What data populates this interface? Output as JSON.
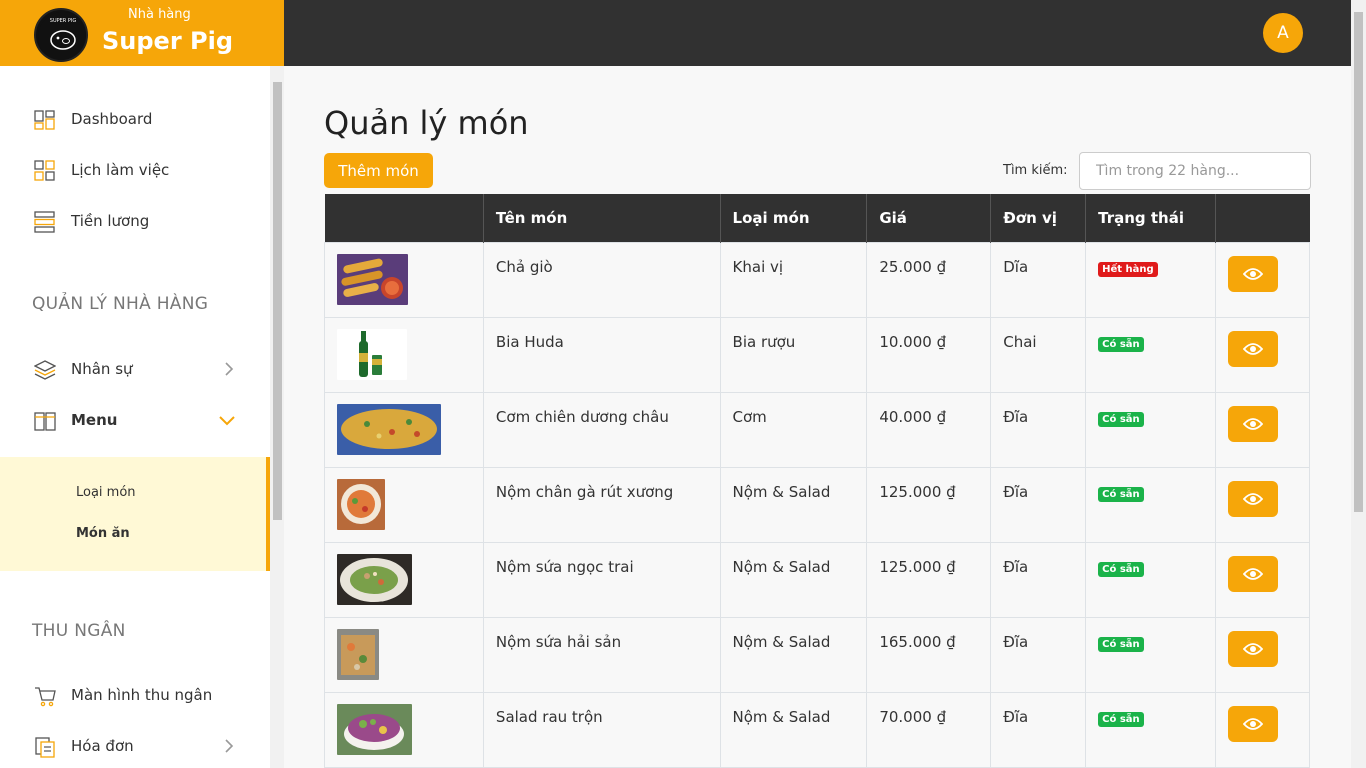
{
  "brand": {
    "subtitle": "Nhà hàng",
    "name": "Super Pig",
    "logo_text": "SUPER PIG"
  },
  "user": {
    "avatar_initial": "A"
  },
  "sidebar": {
    "items": [
      {
        "label": "Dashboard",
        "icon": "dashboard-icon"
      },
      {
        "label": "Lịch làm việc",
        "icon": "grid-icon"
      },
      {
        "label": "Tiền lương",
        "icon": "list-icon"
      }
    ],
    "section_restaurant": "QUẢN LÝ NHÀ HÀNG",
    "staff": {
      "label": "Nhân sự",
      "icon": "layers-icon"
    },
    "menu": {
      "label": "Menu",
      "icon": "book-icon",
      "sub_items": [
        "Loại món",
        "Món ăn"
      ]
    },
    "section_cashier": "THU NGÂN",
    "cashier_screen": {
      "label": "Màn hình thu ngân",
      "icon": "cart-icon"
    },
    "invoices": {
      "label": "Hóa đơn",
      "icon": "invoice-icon"
    }
  },
  "page": {
    "title": "Quản lý món",
    "add_button": "Thêm món",
    "search_label": "Tìm kiếm:",
    "search_placeholder": "Tìm trong 22 hàng..."
  },
  "table": {
    "headers": [
      "",
      "Tên món",
      "Loại món",
      "Giá",
      "Đơn vị",
      "Trạng thái",
      ""
    ],
    "rows": [
      {
        "name": "Chả giò",
        "category": "Khai vị",
        "price": "25.000 ₫",
        "unit": "Dĩa",
        "status": "Hết hàng",
        "status_color": "#e01b1b"
      },
      {
        "name": "Bia Huda",
        "category": "Bia rượu",
        "price": "10.000 ₫",
        "unit": "Chai",
        "status": "Có sẵn",
        "status_color": "#1bb34a"
      },
      {
        "name": "Cơm chiên dương châu",
        "category": "Cơm",
        "price": "40.000 ₫",
        "unit": "Đĩa",
        "status": "Có sẵn",
        "status_color": "#1bb34a"
      },
      {
        "name": "Nộm chân gà rút xương",
        "category": "Nộm & Salad",
        "price": "125.000 ₫",
        "unit": "Đĩa",
        "status": "Có sẵn",
        "status_color": "#1bb34a"
      },
      {
        "name": "Nộm sứa ngọc trai",
        "category": "Nộm & Salad",
        "price": "125.000 ₫",
        "unit": "Đĩa",
        "status": "Có sẵn",
        "status_color": "#1bb34a"
      },
      {
        "name": "Nộm sứa hải sản",
        "category": "Nộm & Salad",
        "price": "165.000 ₫",
        "unit": "Đĩa",
        "status": "Có sẵn",
        "status_color": "#1bb34a"
      },
      {
        "name": "Salad rau trộn",
        "category": "Nộm & Salad",
        "price": "70.000 ₫",
        "unit": "Đĩa",
        "status": "Có sẵn",
        "status_color": "#1bb34a"
      }
    ]
  },
  "colors": {
    "accent": "#f6a609",
    "dark": "#313131",
    "out_of_stock": "#e01b1b",
    "available": "#1bb34a"
  }
}
